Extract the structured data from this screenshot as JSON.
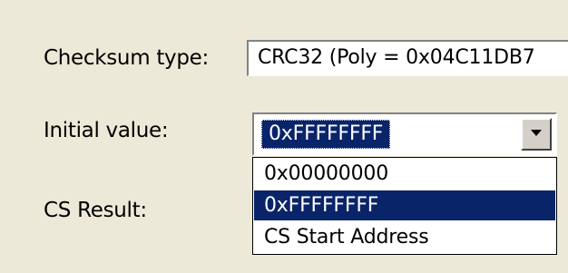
{
  "labels": {
    "checksum_type": "Checksum type:",
    "initial_value": "Initial value:",
    "cs_result": "CS Result:"
  },
  "checksum_type_field": {
    "value": "CRC32 (Poly = 0x04C11DB7"
  },
  "initial_value_combo": {
    "selected": "0xFFFFFFFF",
    "options": [
      "0x00000000",
      "0xFFFFFFFF",
      "CS Start Address"
    ],
    "highlighted_option_index": 1
  },
  "icons": {
    "dropdown": "chevron-down-icon"
  },
  "colors": {
    "dialog_background": "#ece9d8",
    "selection_highlight": "#0a246a",
    "selection_text": "#ffffff"
  }
}
